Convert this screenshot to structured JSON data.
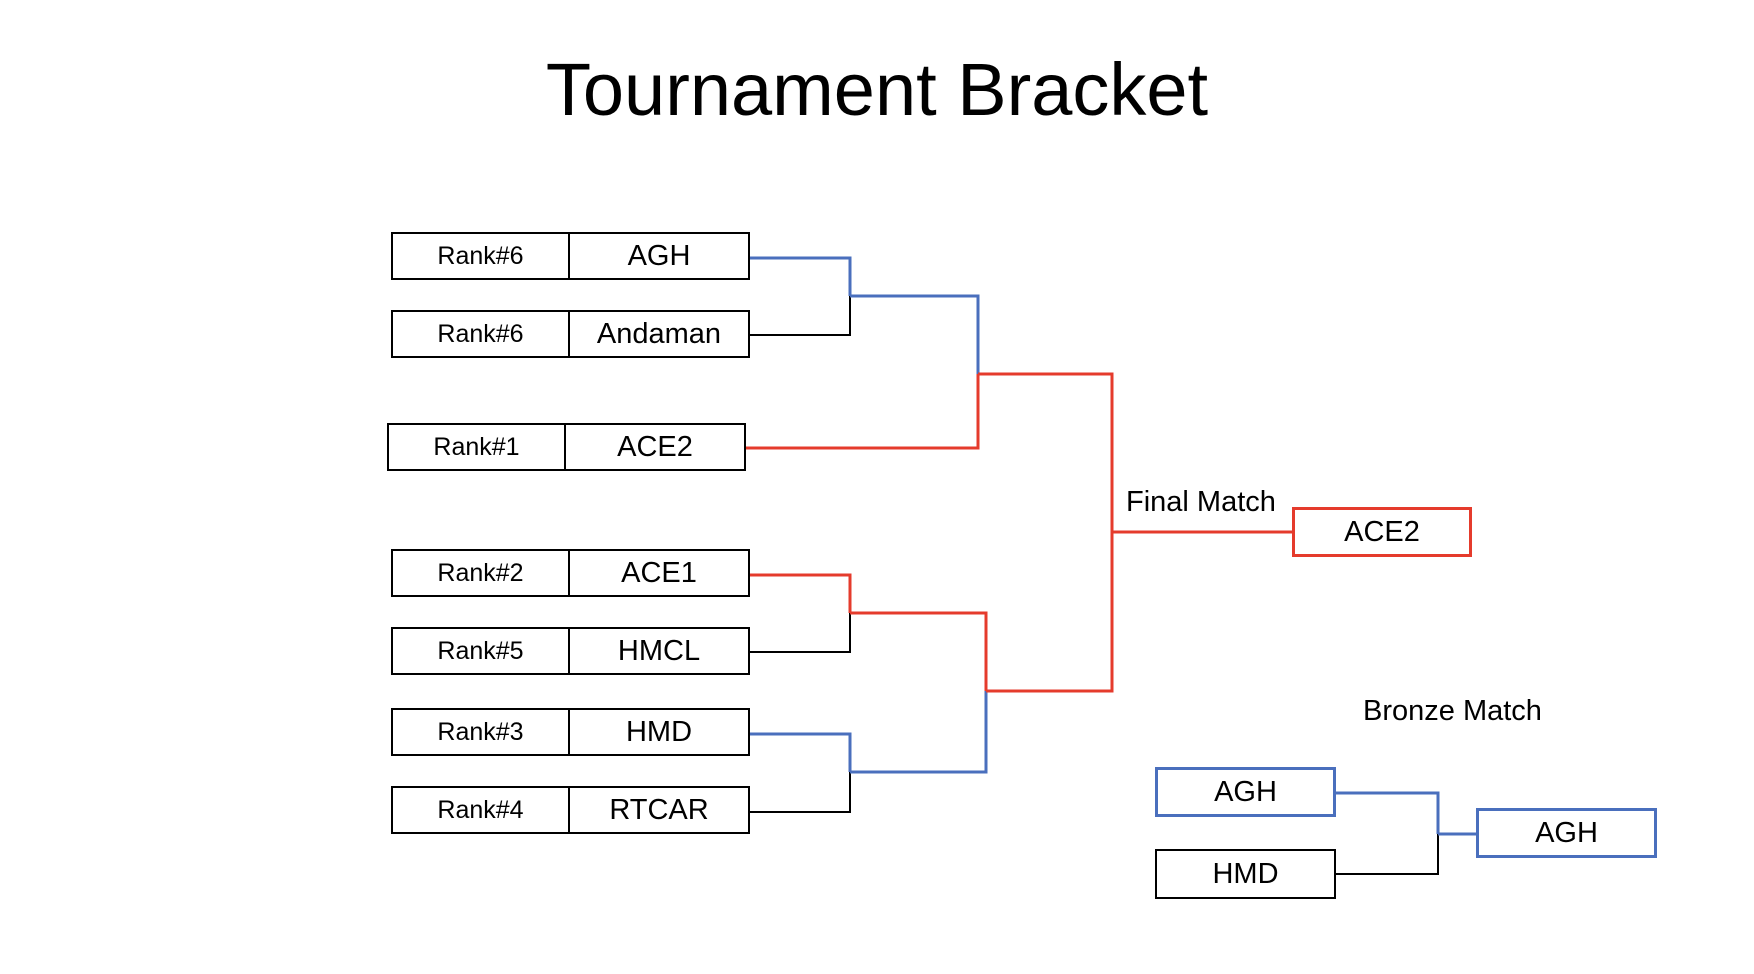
{
  "title": "Tournament Bracket",
  "colors": {
    "winner_path": "#e53b2c",
    "alternate_path": "#4a6fbd",
    "loser_path": "#000000"
  },
  "seeds": [
    {
      "rank": "Rank#6",
      "team": "AGH"
    },
    {
      "rank": "Rank#6",
      "team": "Andaman"
    },
    {
      "rank": "Rank#1",
      "team": "ACE2"
    },
    {
      "rank": "Rank#2",
      "team": "ACE1"
    },
    {
      "rank": "Rank#5",
      "team": "HMCL"
    },
    {
      "rank": "Rank#3",
      "team": "HMD"
    },
    {
      "rank": "Rank#4",
      "team": "RTCAR"
    }
  ],
  "final": {
    "label": "Final Match",
    "winner": "ACE2"
  },
  "bronze": {
    "label": "Bronze Match",
    "team_a": "AGH",
    "team_b": "HMD",
    "winner": "AGH"
  }
}
